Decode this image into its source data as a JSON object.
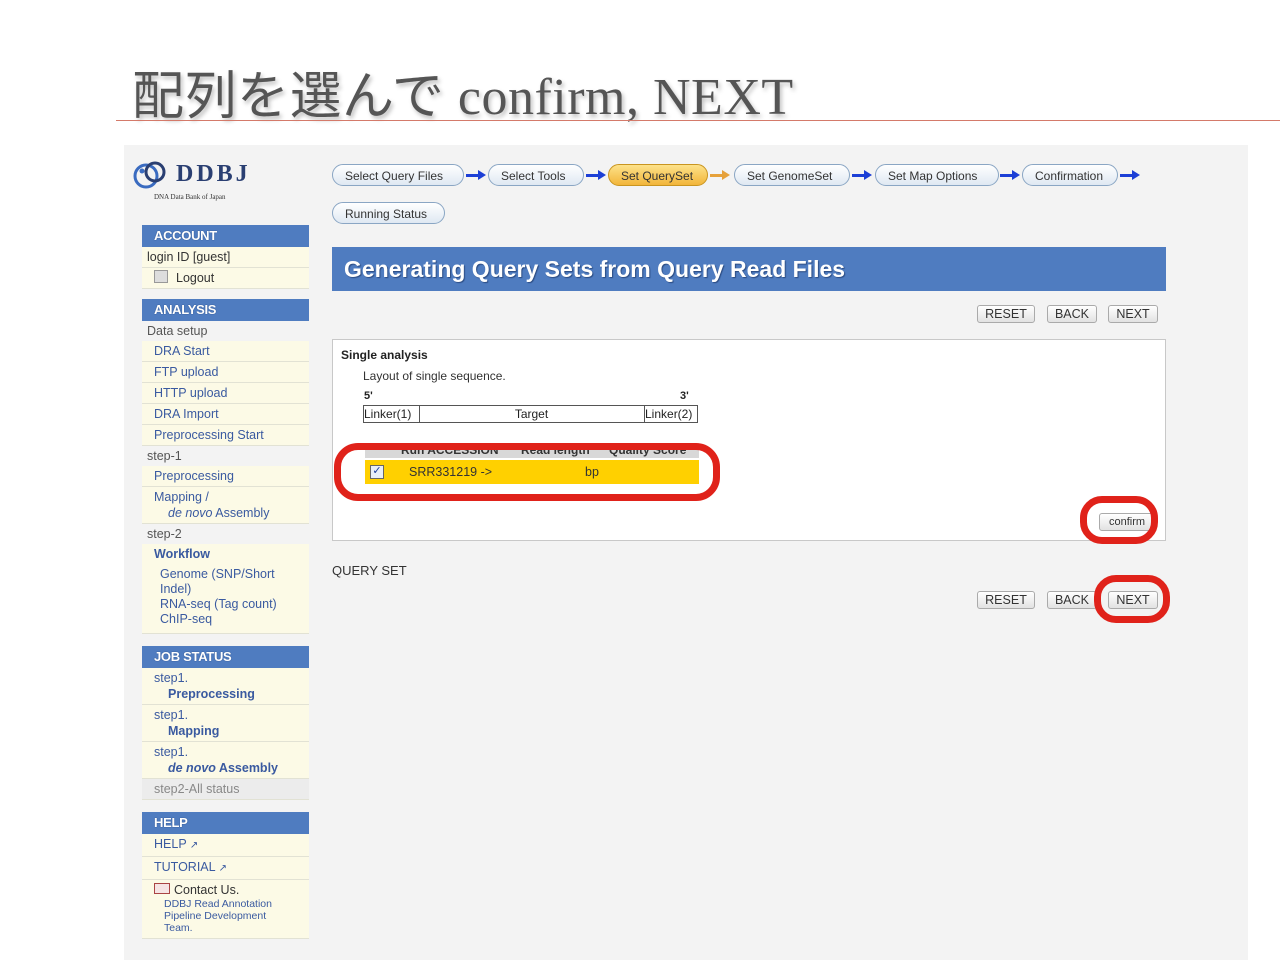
{
  "slide": {
    "title": "配列を選んで confirm, NEXT"
  },
  "logo": {
    "text": "DDBJ",
    "subtitle": "DNA Data Bank of Japan",
    "icon": "ddbj-logo-mark"
  },
  "sidebar": {
    "account": {
      "heading": "ACCOUNT",
      "login_label": "login ID [guest]",
      "logout": "Logout"
    },
    "analysis": {
      "heading": "ANALYSIS",
      "data_setup": "Data setup",
      "items": [
        "DRA Start",
        "FTP upload",
        "HTTP upload",
        "DRA Import",
        "Preprocessing Start"
      ],
      "step1": "step-1",
      "step1_items": [
        "Preprocessing"
      ],
      "mapping_line1": "Mapping /",
      "mapping_line2_it": "de novo",
      "mapping_line2": " Assembly",
      "step2": "step-2",
      "workflow": "Workflow",
      "workflow_items": [
        "Genome (SNP/Short Indel)",
        "RNA-seq (Tag count)",
        "ChIP-seq"
      ]
    },
    "job_status": {
      "heading": "JOB STATUS",
      "entries": [
        {
          "step": "step1.",
          "name": "Preprocessing"
        },
        {
          "step": "step1.",
          "name": "Mapping"
        },
        {
          "step": "step1.",
          "name_it": "de novo",
          "name": " Assembly"
        }
      ],
      "all_status": "step2-All status"
    },
    "help": {
      "heading": "HELP",
      "help": "HELP",
      "tutorial": "TUTORIAL",
      "contact": "Contact Us.",
      "contact_team": "DDBJ Read Annotation Pipeline Development Team."
    }
  },
  "workflow": {
    "steps": [
      "Select Query Files",
      "Select Tools",
      "Set QuerySet",
      "Set GenomeSet",
      "Set Map Options",
      "Confirmation"
    ],
    "active_step": "Set QuerySet",
    "running_status": "Running Status"
  },
  "main": {
    "heading": "Generating Query Sets from Query Read Files",
    "buttons": {
      "reset": "RESET",
      "back": "BACK",
      "next": "NEXT",
      "confirm": "confirm"
    },
    "single": {
      "title": "Single analysis",
      "description": "Layout of single sequence.",
      "five_prime": "5'",
      "three_prime": "3'",
      "linker1": "Linker(1)",
      "target": "Target",
      "linker2": "Linker(2)"
    },
    "table": {
      "headers": [
        "Run ACCESSION",
        "Read length",
        "Quality Score"
      ],
      "rows": [
        {
          "checked": true,
          "accession": "SRR331219 ->",
          "length": "bp",
          "quality": ""
        }
      ]
    },
    "query_set_label": "QUERY SET"
  },
  "colors": {
    "header_blue": "#4f7cc0",
    "highlight_red": "#e0221a",
    "row_yellow": "#ffd000",
    "active_step": "#f2b53a",
    "arrow_blue": "#1c3fd6"
  }
}
